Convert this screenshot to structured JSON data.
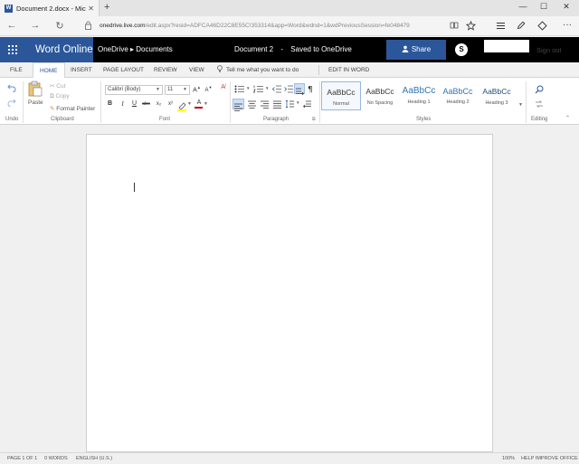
{
  "browser": {
    "tab_title": "Document 2.docx - Mic",
    "tab_close": "✕",
    "new_tab": "+",
    "minimize": "—",
    "maximize": "☐",
    "close": "✕",
    "back": "←",
    "forward": "→",
    "refresh": "↻",
    "url_host": "onedrive.live.com",
    "url_path": "/edit.aspx?resid=ADFCA46D22C8E55C!353314&app=Word&wdnd=1&wdPreviousSession=fe048479"
  },
  "word_header": {
    "app_name": "Word Online",
    "breadcrumb_onedrive": "OneDrive",
    "breadcrumb_sep": "▸",
    "breadcrumb_documents": "Documents",
    "doc_name": "Document 2",
    "dash": "-",
    "save_status": "Saved to OneDrive",
    "share_label": "Share",
    "skype_label": "S",
    "sign_out": "Sign out"
  },
  "ribbon_tabs": [
    "FILE",
    "HOME",
    "INSERT",
    "PAGE LAYOUT",
    "REVIEW",
    "VIEW"
  ],
  "tell_me": "Tell me what you want to do",
  "edit_in_word": "EDIT IN WORD",
  "clipboard": {
    "undo_label": "Undo",
    "paste_label": "Paste",
    "cut_label": "Cut",
    "copy_label": "Copy",
    "format_painter_label": "Format Painter",
    "group_label": "Clipboard"
  },
  "font": {
    "font_name": "Calibri (Body)",
    "font_size": "11",
    "bold": "B",
    "italic": "I",
    "underline": "U",
    "strikethrough": "abc",
    "subscript": "x₂",
    "superscript": "x²",
    "group_label": "Font"
  },
  "paragraph": {
    "group_label": "Paragraph"
  },
  "styles": {
    "items": [
      {
        "preview": "AaBbCc",
        "name": "Normal"
      },
      {
        "preview": "AaBbCc",
        "name": "No Spacing"
      },
      {
        "preview": "AaBbCc",
        "name": "Heading 1"
      },
      {
        "preview": "AaBbCc",
        "name": "Heading 2"
      },
      {
        "preview": "AaBbCc",
        "name": "Heading 3"
      }
    ],
    "group_label": "Styles"
  },
  "editing": {
    "group_label": "Editing"
  },
  "status": {
    "page": "PAGE 1 OF 1",
    "words": "0 WORDS",
    "language": "ENGLISH (U.S.)",
    "zoom": "100%",
    "help": "HELP IMPROVE OFFICE"
  },
  "colors": {
    "word_blue": "#2b579a",
    "header_black": "#000000"
  }
}
